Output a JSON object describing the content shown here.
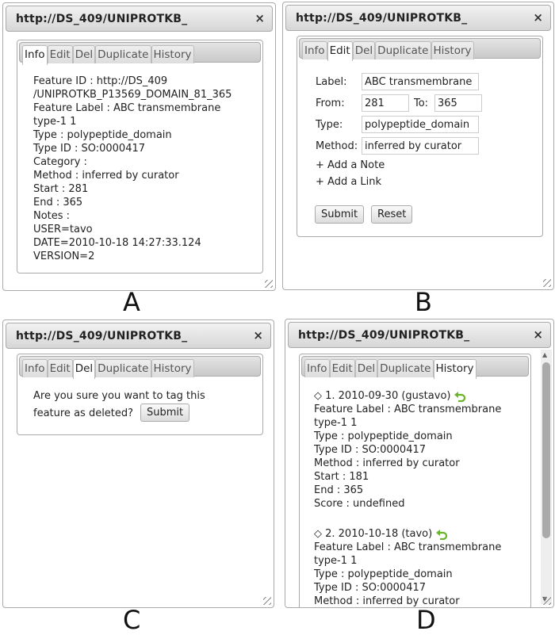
{
  "dialog_title": "http://DS_409/UNIPROTKB_",
  "close_glyph": "×",
  "tabs": [
    "Info",
    "Edit",
    "Del",
    "Duplicate",
    "History"
  ],
  "panel_letters": [
    "A",
    "B",
    "C",
    "D"
  ],
  "info": {
    "lines": "Feature ID : http://DS_409\n/UNIPROTKB_P13569_DOMAIN_81_365\nFeature Label : ABC transmembrane\ntype-1 1\nType : polypeptide_domain\nType ID : SO:0000417\nCategory :\nMethod : inferred by curator\nStart : 281\nEnd : 365\nNotes :\nUSER=tavo\nDATE=2010-10-18 14:27:33.124\nVERSION=2"
  },
  "edit": {
    "label_label": "Label:",
    "label_value": "ABC transmembrane",
    "from_label": "From:",
    "from_value": "281",
    "to_label": "To:",
    "to_value": "365",
    "type_label": "Type:",
    "type_value": "polypeptide_domain",
    "method_label": "Method:",
    "method_value": "inferred by curator",
    "add_note": "+ Add a Note",
    "add_link": "+ Add a Link",
    "submit": "Submit",
    "reset": "Reset"
  },
  "del": {
    "line1": "Are you sure you want to tag this",
    "line2": "feature as deleted?",
    "submit": "Submit"
  },
  "history": {
    "entries": [
      {
        "head": "◇ 1. 2010-09-30 (gustavo)",
        "lines": "Feature Label : ABC transmembrane\ntype-1 1\nType : polypeptide_domain\nType ID : SO:0000417\nMethod : inferred by curator\nStart : 181\nEnd : 365\nScore : undefined"
      },
      {
        "head": "◇ 2. 2010-10-18 (tavo)",
        "lines": "Feature Label : ABC transmembrane\ntype-1 1\nType : polypeptide_domain\nType ID : SO:0000417\nMethod : inferred by curator"
      }
    ]
  },
  "colors": {
    "revert_icon": "#6ab42a"
  }
}
